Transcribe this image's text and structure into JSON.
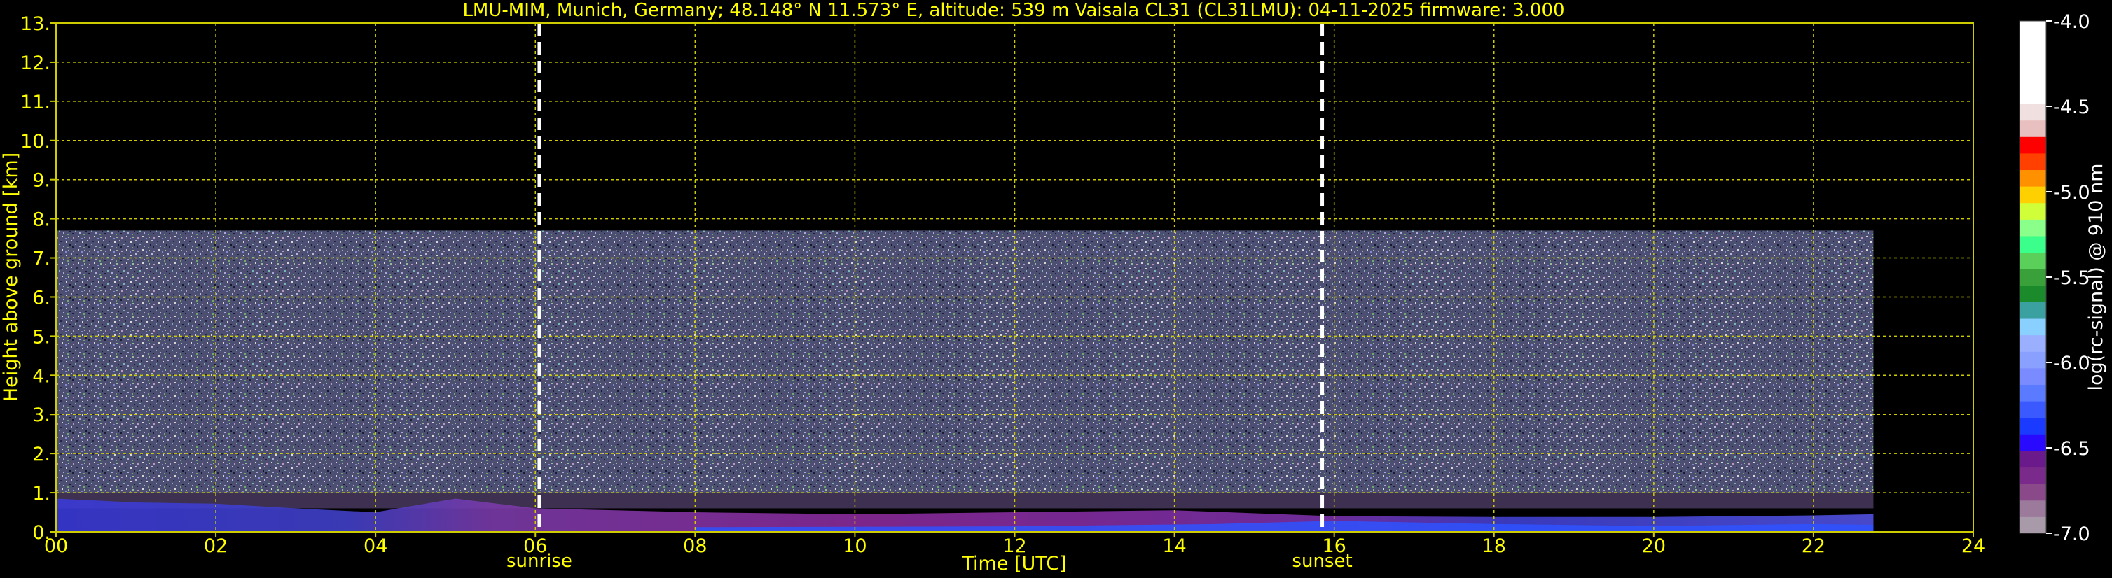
{
  "chart_data": {
    "type": "heatmap",
    "title": "LMU-MIM, Munich, Germany; 48.148° N 11.573° E, altitude: 539 m    Vaisala CL31 (CL31LMU): 04-11-2025    firmware: 3.000",
    "xlabel": "Time [UTC]",
    "ylabel": "Height above ground [km]",
    "xlim": [
      0,
      24
    ],
    "ylim": [
      0,
      13
    ],
    "x_ticks": [
      "00",
      "02",
      "04",
      "06",
      "08",
      "10",
      "12",
      "14",
      "16",
      "18",
      "20",
      "22",
      "24"
    ],
    "y_ticks": [
      "0.",
      "1.",
      "2.",
      "3.",
      "4.",
      "5.",
      "6.",
      "7.",
      "8.",
      "9.",
      "10.",
      "11.",
      "12.",
      "13."
    ],
    "grid": true,
    "colorbar": {
      "label": "log(rc-signal) @ 910 nm",
      "range": [
        -7.0,
        -4.0
      ],
      "ticks": [
        "-4.0",
        "-4.5",
        "-5.0",
        "-5.5",
        "-6.0",
        "-6.5",
        "-7.0"
      ]
    },
    "data_extent": {
      "time_end": 22.75,
      "max_height": 7.7
    },
    "layers": [
      {
        "name": "noise",
        "height": [
          1.0,
          7.7
        ],
        "time": [
          0,
          22.75
        ],
        "level": -6.2
      },
      {
        "name": "boundary-layer",
        "height": [
          0,
          0.9
        ],
        "time": [
          0,
          22.75
        ],
        "level": -6.5
      },
      {
        "name": "surface",
        "height": [
          0,
          0.15
        ],
        "time": [
          8,
          22.75
        ],
        "level": -6.3
      }
    ],
    "annotations": [
      {
        "label": "sunrise",
        "x": 6.05
      },
      {
        "label": "sunset",
        "x": 15.85
      }
    ]
  },
  "colors": {
    "text": "#ffff00",
    "grid": "#cccc00",
    "marker_line": "#ffffff",
    "background": "#000000"
  }
}
